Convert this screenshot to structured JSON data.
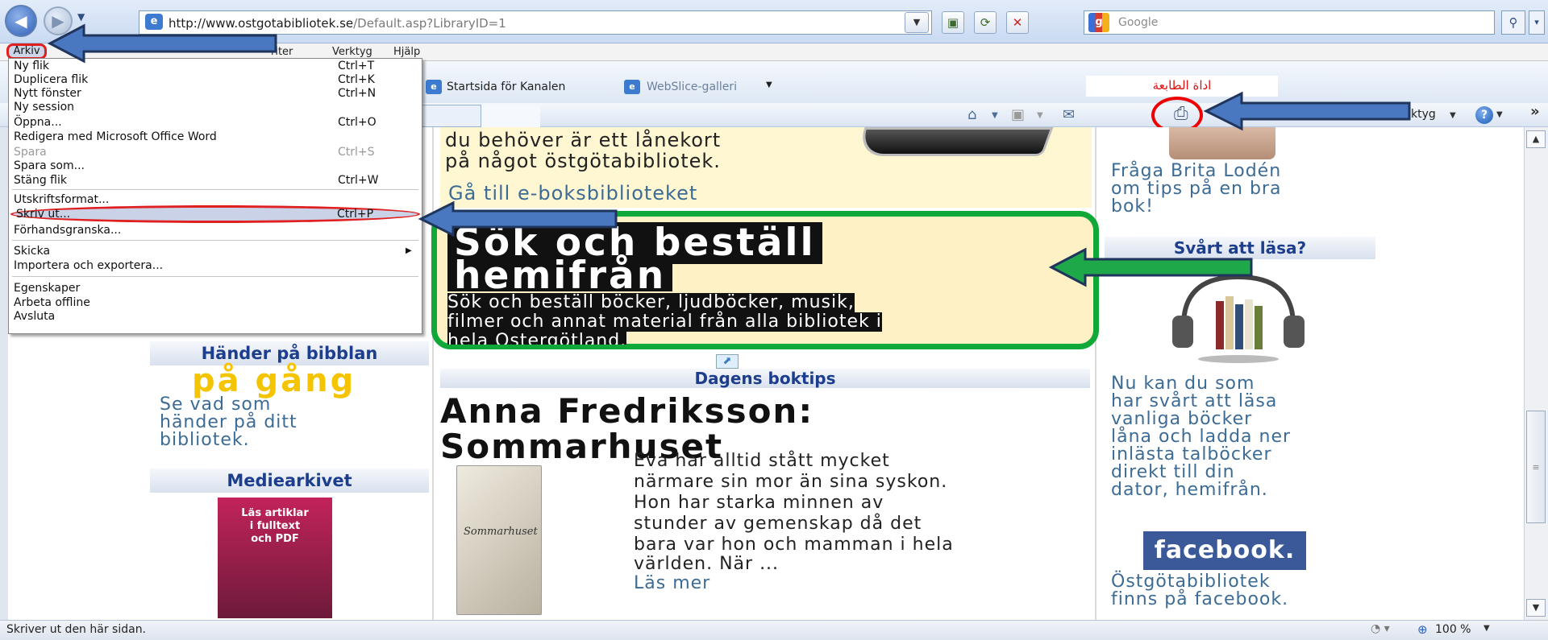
{
  "browser": {
    "url_domain": "http://www.ostgotabibliotek.se",
    "url_path": "/Default.asp?LibraryID=1",
    "search_placeholder": "Google",
    "tools_label": "ktyg",
    "chevron": "»"
  },
  "menubar": {
    "arkiv": "Arkiv",
    "favoriter": "riter",
    "verktyg": "Verktyg",
    "hjalp": "Hjälp"
  },
  "favorites": {
    "startsida": "Startsida för Kanalen",
    "webslice": "WebSlice-galleri"
  },
  "callout_arabic": "اداة الطابعة",
  "arkiv_menu": {
    "items": [
      {
        "label": "Ny flik",
        "shortcut": "Ctrl+T"
      },
      {
        "label": "Duplicera flik",
        "shortcut": "Ctrl+K"
      },
      {
        "label": "Nytt fönster",
        "shortcut": "Ctrl+N"
      },
      {
        "label": "Ny session",
        "shortcut": ""
      },
      {
        "label": "Öppna...",
        "shortcut": "Ctrl+O"
      },
      {
        "label": "Redigera med Microsoft Office Word",
        "shortcut": ""
      },
      {
        "label": "Spara",
        "shortcut": "Ctrl+S"
      },
      {
        "label": "Spara som...",
        "shortcut": ""
      },
      {
        "label": "Stäng flik",
        "shortcut": "Ctrl+W"
      },
      {
        "label": "Utskriftsformat...",
        "shortcut": ""
      },
      {
        "label": "Skriv ut...",
        "shortcut": "Ctrl+P"
      },
      {
        "label": "Förhandsgranska...",
        "shortcut": ""
      },
      {
        "label": "Skicka",
        "shortcut": ""
      },
      {
        "label": "Importera och exportera...",
        "shortcut": ""
      },
      {
        "label": "Egenskaper",
        "shortcut": ""
      },
      {
        "label": "Arbeta offline",
        "shortcut": ""
      },
      {
        "label": "Avsluta",
        "shortcut": ""
      }
    ]
  },
  "page": {
    "ebook": {
      "line1": "du behöver är ett lånekort",
      "line2": "på något östgötabibliotek.",
      "link": "Gå till e-boksbiblioteket"
    },
    "sok": {
      "title_line1": "Sök och beställ",
      "title_line2": "hemifrån",
      "text_line1": "Sök och beställ böcker, ljudböcker, musik,",
      "text_line2": "filmer och annat material från alla bibliotek i",
      "text_line3": "hela Östergötland."
    },
    "dagens": {
      "header": "Dagens boktips",
      "title_line1": "Anna Fredriksson:",
      "title_line2": "Sommarhuset",
      "book_cover_text": "Sommarhuset",
      "text_lines": [
        "Eva har alltid stått mycket",
        "närmare sin mor än sina syskon.",
        "Hon har starka minnen av",
        "stunder av gemenskap då det",
        "bara var hon och mamman i hela",
        "världen. När ..."
      ],
      "read_more": "Läs mer"
    },
    "hander": {
      "header": "Händer på bibblan",
      "logo_text": "på gång",
      "text_line1": "Se vad som",
      "text_line2": "händer på ditt",
      "text_line3": "bibliotek."
    },
    "media": {
      "header": "Mediearkivet",
      "promo_line1": "Läs artiklar",
      "promo_line2": "i fulltext",
      "promo_line3": "och PDF"
    },
    "right": {
      "fraga_line1": "Fråga Brita Lodén",
      "fraga_line2": "om tips på en bra",
      "fraga_line3": "bok!",
      "svart_header": "Svårt att läsa?",
      "svart_lines": [
        "Nu kan du som",
        "har svårt att läsa",
        "vanliga böcker",
        "låna och ladda ner",
        "inlästa talböcker",
        "direkt till din",
        "dator, hemifrån."
      ],
      "facebook_label": "facebook.",
      "facebook_line1": "Östgötabibliotek",
      "facebook_line2": "finns på facebook."
    }
  },
  "status": {
    "text": "Skriver ut den här sidan.",
    "zoom": "100 %"
  },
  "colors": {
    "annotation_arrow": "#4a78c0",
    "annotation_ring": "#e02020",
    "green_box": "#11a83a"
  }
}
